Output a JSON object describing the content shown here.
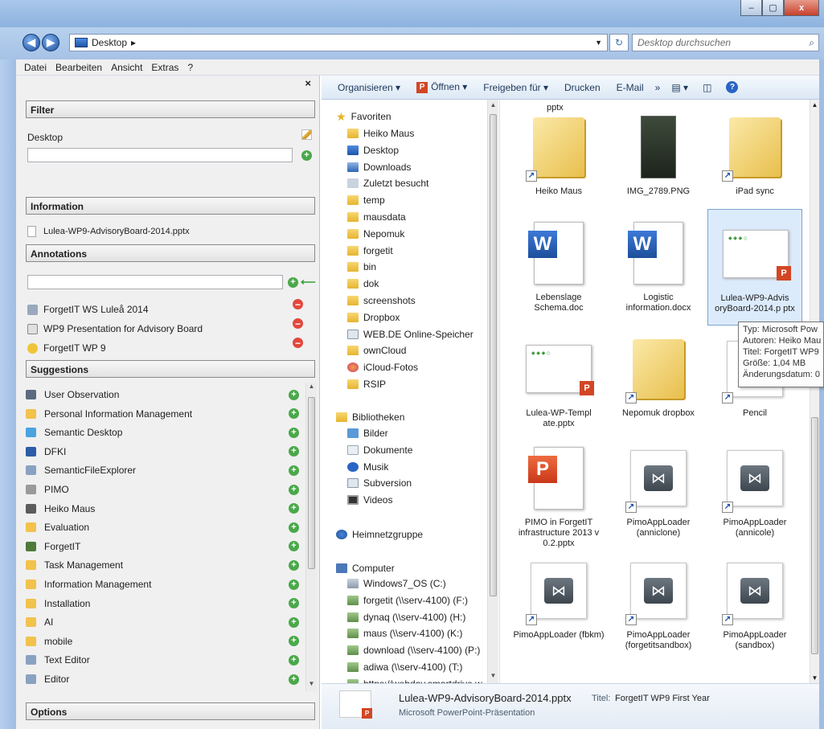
{
  "window": {
    "minimize": "–",
    "maximize": "▢",
    "close": "x"
  },
  "address": {
    "location": "Desktop",
    "separator": "▸",
    "search_placeholder": "Desktop durchsuchen"
  },
  "menu": [
    "Datei",
    "Bearbeiten",
    "Ansicht",
    "Extras",
    "?"
  ],
  "left_panel": {
    "close": "×",
    "filter": {
      "header": "Filter",
      "label": "Desktop"
    },
    "information": {
      "header": "Information",
      "file": "Lulea-WP9-AdvisoryBoard-2014.pptx"
    },
    "annotations": {
      "header": "Annotations",
      "items": [
        {
          "label": "ForgetIT WS Luleå 2014",
          "icon": "eye-icon"
        },
        {
          "label": "WP9 Presentation for Advisory Board",
          "icon": "document-icon"
        },
        {
          "label": "ForgetIT WP 9",
          "icon": "project-icon"
        }
      ]
    },
    "suggestions": {
      "header": "Suggestions",
      "items": [
        {
          "label": "User Observation",
          "color": "#5a6a80"
        },
        {
          "label": "Personal Information Management",
          "color": "#f1c24c"
        },
        {
          "label": "Semantic Desktop",
          "color": "#4aa3df"
        },
        {
          "label": "DFKI",
          "color": "#2c5ca8"
        },
        {
          "label": "SemanticFileExplorer",
          "color": "#8aa2c2"
        },
        {
          "label": "PIMO",
          "color": "#9a9a9a"
        },
        {
          "label": "Heiko Maus",
          "color": "#5b5b5b"
        },
        {
          "label": "Evaluation",
          "color": "#f1c24c"
        },
        {
          "label": "ForgetIT",
          "color": "#4f7a3a"
        },
        {
          "label": "Task Management",
          "color": "#f1c24c"
        },
        {
          "label": "Information Management",
          "color": "#f1c24c"
        },
        {
          "label": "Installation",
          "color": "#f1c24c"
        },
        {
          "label": "AI",
          "color": "#f1c24c"
        },
        {
          "label": "mobile",
          "color": "#f1c24c"
        },
        {
          "label": "Text Editor",
          "color": "#8aa2c2"
        },
        {
          "label": "Editor",
          "color": "#8aa2c2"
        }
      ]
    },
    "options": {
      "header": "Options"
    }
  },
  "toolbar": {
    "organize": "Organisieren ▾",
    "open": "Öffnen ▾",
    "share": "Freigeben für ▾",
    "print": "Drucken",
    "email": "E-Mail",
    "more": "»",
    "help": "?"
  },
  "nav_tree": {
    "favorites_header": "Favoriten",
    "favorites": [
      "Heiko Maus",
      "Desktop",
      "Downloads",
      "Zuletzt besucht",
      "temp",
      "mausdata",
      "Nepomuk",
      "forgetit",
      "bin",
      "dok",
      "screenshots",
      "Dropbox",
      "WEB.DE Online-Speicher",
      "ownCloud",
      "iCloud-Fotos",
      "RSIP"
    ],
    "libraries_header": "Bibliotheken",
    "libraries": [
      "Bilder",
      "Dokumente",
      "Musik",
      "Subversion",
      "Videos"
    ],
    "homegroup": "Heimnetzgruppe",
    "computer_header": "Computer",
    "computer": [
      "Windows7_OS (C:)",
      "forgetit (\\\\serv-4100) (F:)",
      "dynaq (\\\\serv-4100) (H:)",
      "maus (\\\\serv-4100) (K:)",
      "download (\\\\serv-4100) (P:)",
      "adiwa (\\\\serv-4100) (T:)",
      "https://webdav.smartdrive.w"
    ]
  },
  "files": {
    "top_partial": "pptx",
    "items": [
      {
        "name": "Heiko Maus",
        "kind": "folder"
      },
      {
        "name": "IMG_2789.PNG",
        "kind": "image"
      },
      {
        "name": "iPad sync",
        "kind": "folder"
      },
      {
        "name": "Lebenslage Schema.doc",
        "kind": "word"
      },
      {
        "name": "Logistic information.docx",
        "kind": "word"
      },
      {
        "name": "Lulea-WP9-Advis oryBoard-2014.p ptx",
        "kind": "slide"
      },
      {
        "name": "Lulea-WP-Templ ate.pptx",
        "kind": "slide"
      },
      {
        "name": "Nepomuk dropbox",
        "kind": "folder"
      },
      {
        "name": "Pencil",
        "kind": "app"
      },
      {
        "name": "PIMO in ForgetIT infrastructure 2013 v 0.2.pptx",
        "kind": "ppt"
      },
      {
        "name": "PimoAppLoader (anniclone)",
        "kind": "app"
      },
      {
        "name": "PimoAppLoader (annicole)",
        "kind": "app"
      },
      {
        "name": "PimoAppLoader (fbkm)",
        "kind": "app"
      },
      {
        "name": "PimoAppLoader (forgetitsandbox)",
        "kind": "app"
      },
      {
        "name": "PimoAppLoader (sandbox)",
        "kind": "app"
      }
    ]
  },
  "tooltip": {
    "lines": [
      "Typ: Microsoft Pow",
      "Autoren: Heiko Mau",
      "Titel: ForgetIT WP9",
      "Größe: 1,04 MB",
      "Änderungsdatum: 0"
    ]
  },
  "details": {
    "name": "Lulea-WP9-AdvisoryBoard-2014.pptx",
    "type": "Microsoft PowerPoint-Präsentation",
    "title_label": "Titel:",
    "title_value": "ForgetIT WP9 First Year"
  }
}
